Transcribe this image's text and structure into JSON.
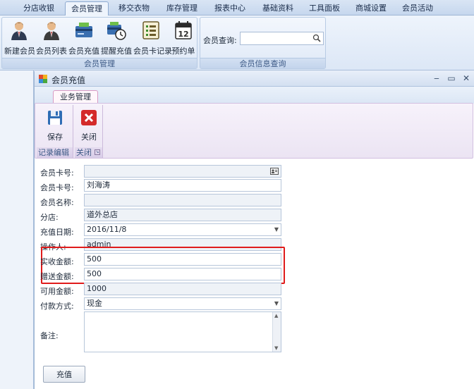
{
  "menu": {
    "tabs": [
      {
        "label": "分店收银"
      },
      {
        "label": "会员管理"
      },
      {
        "label": "移交衣物"
      },
      {
        "label": "库存管理"
      },
      {
        "label": "报表中心"
      },
      {
        "label": "基础资料"
      },
      {
        "label": "工具面板"
      },
      {
        "label": "商城设置"
      },
      {
        "label": "会员活动"
      }
    ],
    "active_index": 1
  },
  "ribbon": {
    "group_member": {
      "title": "会员管理",
      "buttons": [
        {
          "label": "新建会员",
          "icon": "person-add-icon"
        },
        {
          "label": "会员列表",
          "icon": "person-list-icon"
        },
        {
          "label": "会员充值",
          "icon": "member-card-icon"
        },
        {
          "label": "提醒充值",
          "icon": "recharge-reminder-icon"
        },
        {
          "label": "会员卡记录",
          "icon": "card-record-icon"
        },
        {
          "label": "预约单",
          "icon": "calendar-icon"
        }
      ]
    },
    "group_query": {
      "title": "会员信息查询",
      "search_label": "会员查询:",
      "search_value": ""
    }
  },
  "window": {
    "title": "会员充值",
    "subtab": "业务管理",
    "groups": [
      {
        "title": "记录编辑",
        "button": "保存"
      },
      {
        "title": "关闭",
        "button": "关闭"
      }
    ]
  },
  "form": {
    "card_lookup_label": "会员卡号:",
    "card_no_label": "会员卡号:",
    "card_no_value": "刘海涛",
    "member_name_label": "会员名称:",
    "member_name_value": "",
    "branch_label": "分店:",
    "branch_value": "道外总店",
    "date_label": "充值日期:",
    "date_value": "2016/11/8",
    "operator_label": "操作人:",
    "operator_value": "admin",
    "received_label": "实收金额:",
    "received_value": "500",
    "bonus_label": "赠送金额:",
    "bonus_value": "500",
    "available_label": "可用金额:",
    "available_value": "1000",
    "payment_label": "付款方式:",
    "payment_value": "现金",
    "note_label": "备注:",
    "submit_label": "充值"
  },
  "colors": {
    "highlight": "#e01b1b",
    "accent": "#c6d7ee"
  }
}
